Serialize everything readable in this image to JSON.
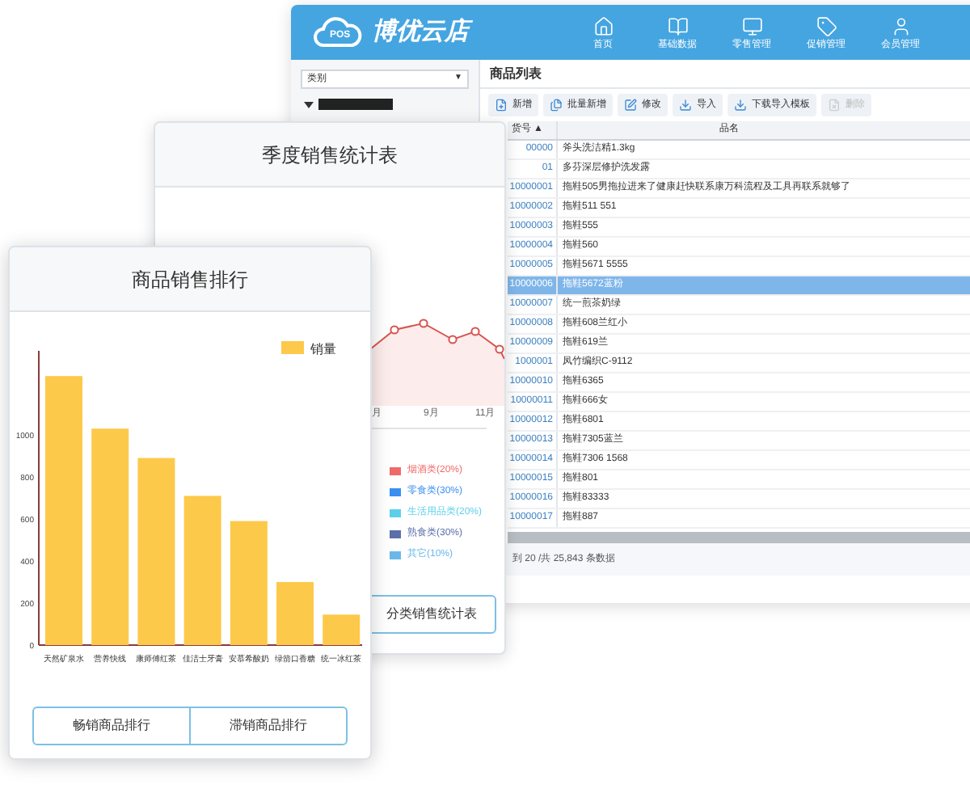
{
  "app_window": {
    "logo_badge": "POS",
    "logo_text": "博优云店",
    "nav": [
      {
        "label": "首页"
      },
      {
        "label": "基础数据"
      },
      {
        "label": "零售管理"
      },
      {
        "label": "促销管理"
      },
      {
        "label": "会员管理"
      }
    ],
    "sidebar": {
      "category_select": "类别",
      "select_caret": "▼",
      "tree_item": {
        "expanded": true
      }
    },
    "panel_title": "商品列表",
    "toolbar": [
      {
        "label": "新增",
        "disabled": false
      },
      {
        "label": "批量新增",
        "disabled": false
      },
      {
        "label": "修改",
        "disabled": false
      },
      {
        "label": "导入",
        "disabled": false
      },
      {
        "label": "下载导入模板",
        "disabled": false
      },
      {
        "label": "删除",
        "disabled": true
      }
    ],
    "table": {
      "columns": [
        "货号 ▲",
        "品名"
      ],
      "rows": [
        {
          "code": "00000",
          "name": "斧头洗洁精1.3kg",
          "selected": false
        },
        {
          "code": "01",
          "name": "多芬深层修护洗发露",
          "selected": false
        },
        {
          "code": "10000001",
          "name": "拖鞋505男拖拉进来了健康赶快联系康万科流程及工具再联系就够了",
          "selected": false
        },
        {
          "code": "10000002",
          "name": "拖鞋511 551",
          "selected": false
        },
        {
          "code": "10000003",
          "name": "拖鞋555",
          "selected": false
        },
        {
          "code": "10000004",
          "name": "拖鞋560",
          "selected": false
        },
        {
          "code": "10000005",
          "name": "拖鞋5671 5555",
          "selected": false
        },
        {
          "code": "10000006",
          "name": "拖鞋5672蓝粉",
          "selected": true
        },
        {
          "code": "10000007",
          "name": "统一煎茶奶绿",
          "selected": false
        },
        {
          "code": "10000008",
          "name": "拖鞋608兰红小",
          "selected": false
        },
        {
          "code": "10000009",
          "name": "拖鞋619兰",
          "selected": false
        },
        {
          "code": "1000001",
          "name": "凤竹编织C-9112",
          "selected": false
        },
        {
          "code": "10000010",
          "name": "拖鞋6365",
          "selected": false
        },
        {
          "code": "10000011",
          "name": "拖鞋666女",
          "selected": false
        },
        {
          "code": "10000012",
          "name": "拖鞋6801",
          "selected": false
        },
        {
          "code": "10000013",
          "name": "拖鞋7305蓝兰",
          "selected": false
        },
        {
          "code": "10000014",
          "name": "拖鞋7306 1568",
          "selected": false
        },
        {
          "code": "10000015",
          "name": "拖鞋801",
          "selected": false
        },
        {
          "code": "10000016",
          "name": "拖鞋83333",
          "selected": false
        },
        {
          "code": "10000017",
          "name": "拖鞋887",
          "selected": false
        }
      ]
    },
    "status": "到 20 /共 25,843 条数据"
  },
  "quarter_card": {
    "title": "季度销售统计表",
    "month_labels": [
      "月",
      "9月",
      "11月"
    ],
    "legend": [
      {
        "label": "烟酒类(20%)",
        "color": "#f06a6a"
      },
      {
        "label": "零食类(30%)",
        "color": "#3b8ff0"
      },
      {
        "label": "生活用品类(20%)",
        "color": "#5cd0ea"
      },
      {
        "label": "熟食类(30%)",
        "color": "#5b6fa8"
      },
      {
        "label": "其它(10%)",
        "color": "#6ab8ea"
      }
    ],
    "button": "分类销售统计表"
  },
  "ranking_card": {
    "title": "商品销售排行",
    "chart_data": {
      "type": "bar",
      "categories": [
        "天然矿泉水",
        "营养快线",
        "康师傅红茶",
        "佳洁士牙膏",
        "安慕希酸奶",
        "绿箭口香糖",
        "统一冰红茶"
      ],
      "series": [
        {
          "name": "销量",
          "color": "#fdc94a",
          "values": [
            1280,
            1030,
            890,
            710,
            590,
            300,
            145
          ]
        }
      ],
      "ylim": [
        0,
        1400
      ],
      "yticks": [
        0,
        200,
        400,
        600,
        800,
        1000
      ]
    },
    "buttons": [
      "畅销商品排行",
      "滞销商品排行"
    ]
  }
}
